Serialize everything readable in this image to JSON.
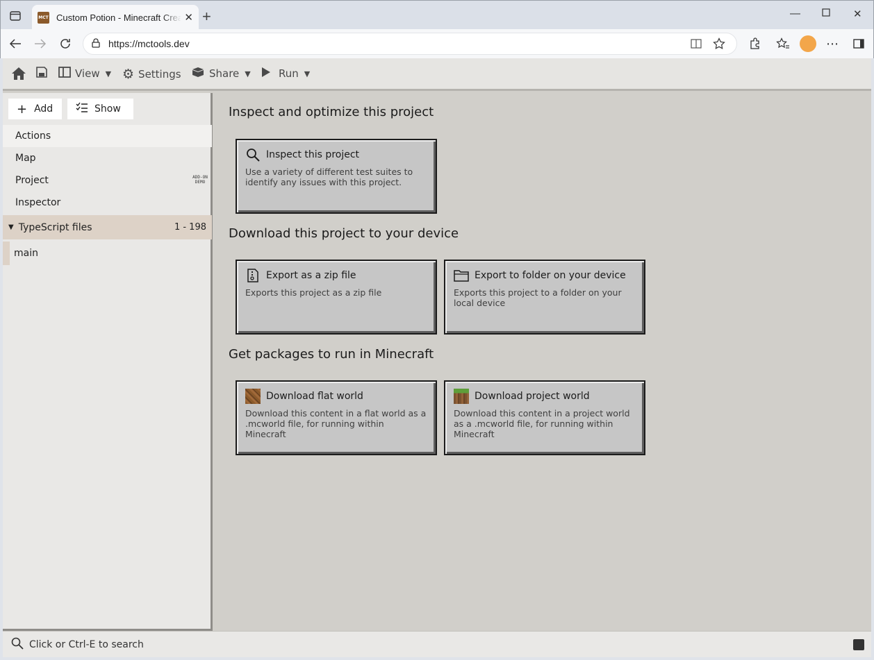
{
  "browser": {
    "tab_title": "Custom Potion - Minecraft Creator Tools",
    "favicon_text": "MCT",
    "url": "https://mctools.dev"
  },
  "toolbar": {
    "view_label": "View",
    "settings_label": "Settings",
    "share_label": "Share",
    "run_label": "Run"
  },
  "sidebar": {
    "add_label": "Add",
    "show_label": "Show",
    "items": [
      {
        "label": "Actions"
      },
      {
        "label": "Map"
      },
      {
        "label": "Project",
        "badge": "ADD-ON DEMO"
      },
      {
        "label": "Inspector"
      }
    ],
    "group": {
      "label": "TypeScript files",
      "count": "1 - 198"
    },
    "group_items": [
      {
        "label": "main"
      }
    ]
  },
  "main": {
    "sections": [
      {
        "title": "Inspect and optimize this project",
        "cards": [
          {
            "icon": "search-icon",
            "title": "Inspect this project",
            "desc": "Use a variety of different test suites to identify any issues with this project."
          }
        ]
      },
      {
        "title": "Download this project to your device",
        "cards": [
          {
            "icon": "zip-file-icon",
            "title": "Export as a zip file",
            "desc": "Exports this project as a zip file"
          },
          {
            "icon": "folder-icon",
            "title": "Export to folder on your device",
            "desc": "Exports this project to a folder on your local device"
          }
        ]
      },
      {
        "title": "Get packages to run in Minecraft",
        "cards": [
          {
            "icon": "dirt-block-icon",
            "title": "Download flat world",
            "desc": "Download this content in a flat world as a .mcworld file, for running within Minecraft"
          },
          {
            "icon": "grass-block-icon",
            "title": "Download project world",
            "desc": "Download this content in a project world as a .mcworld file, for running within Minecraft"
          }
        ]
      }
    ]
  },
  "statusbar": {
    "search_placeholder": "Click or Ctrl-E to search"
  }
}
